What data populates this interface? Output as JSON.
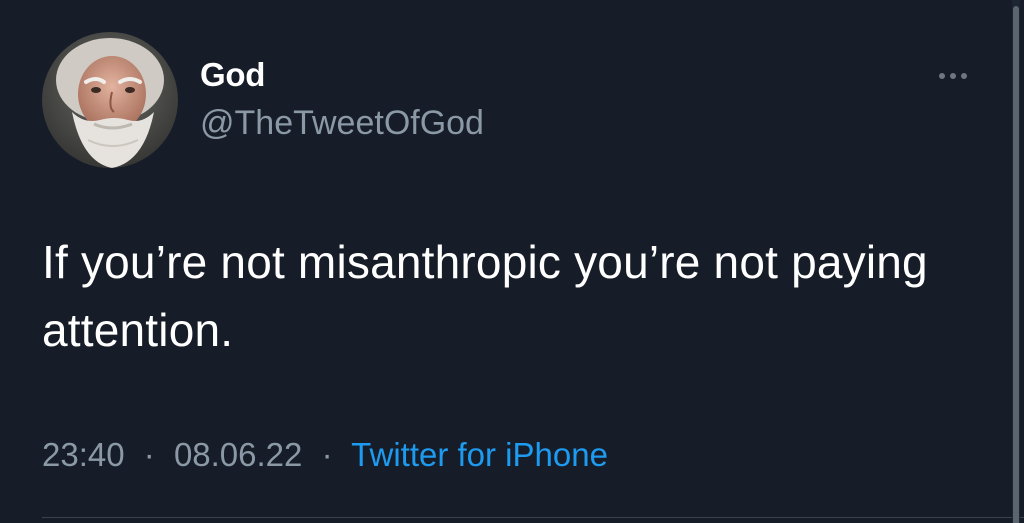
{
  "tweet": {
    "author": {
      "display_name": "God",
      "handle": "@TheTweetOfGod",
      "avatar_icon": "avatar-bearded-man"
    },
    "more_icon": "more-horizontal-icon",
    "text": "If you’re not misanthropic you’re not paying attention.",
    "time": "23:40",
    "separator": "·",
    "date": "08.06.22",
    "source": "Twitter for iPhone"
  },
  "colors": {
    "background": "#161d28",
    "text_primary": "#ffffff",
    "text_secondary": "#8b98a5",
    "link": "#1d9bf0",
    "divider": "#38444d"
  }
}
